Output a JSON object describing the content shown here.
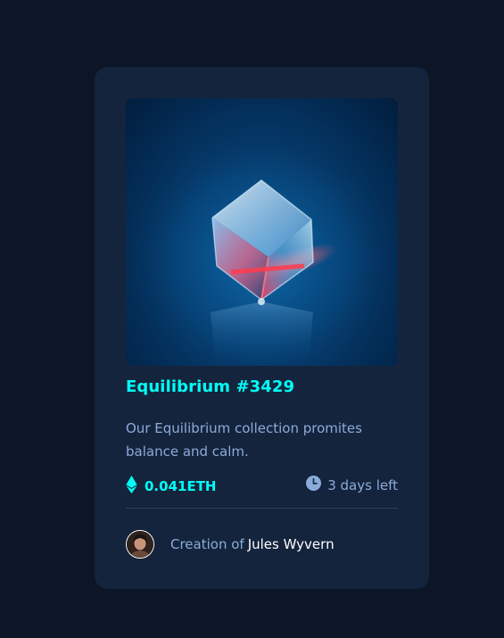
{
  "nft": {
    "image_alt": "Glowing crystal cube on blue surface",
    "title": "Equilibrium #3429",
    "description": "Our Equilibrium collection promites balance and calm.",
    "price": "0.041ETH",
    "time_left": "3 days left"
  },
  "creator": {
    "prefix": "Creation of",
    "name": "Jules Wyvern"
  },
  "icons": {
    "eth": "ethereum-icon",
    "clock": "clock-icon"
  },
  "colors": {
    "background": "#0d1627",
    "card": "#15243d",
    "accent_cyan": "#00fff7",
    "soft_blue": "#8bacd9",
    "divider": "#2e405a",
    "white": "#ffffff"
  }
}
